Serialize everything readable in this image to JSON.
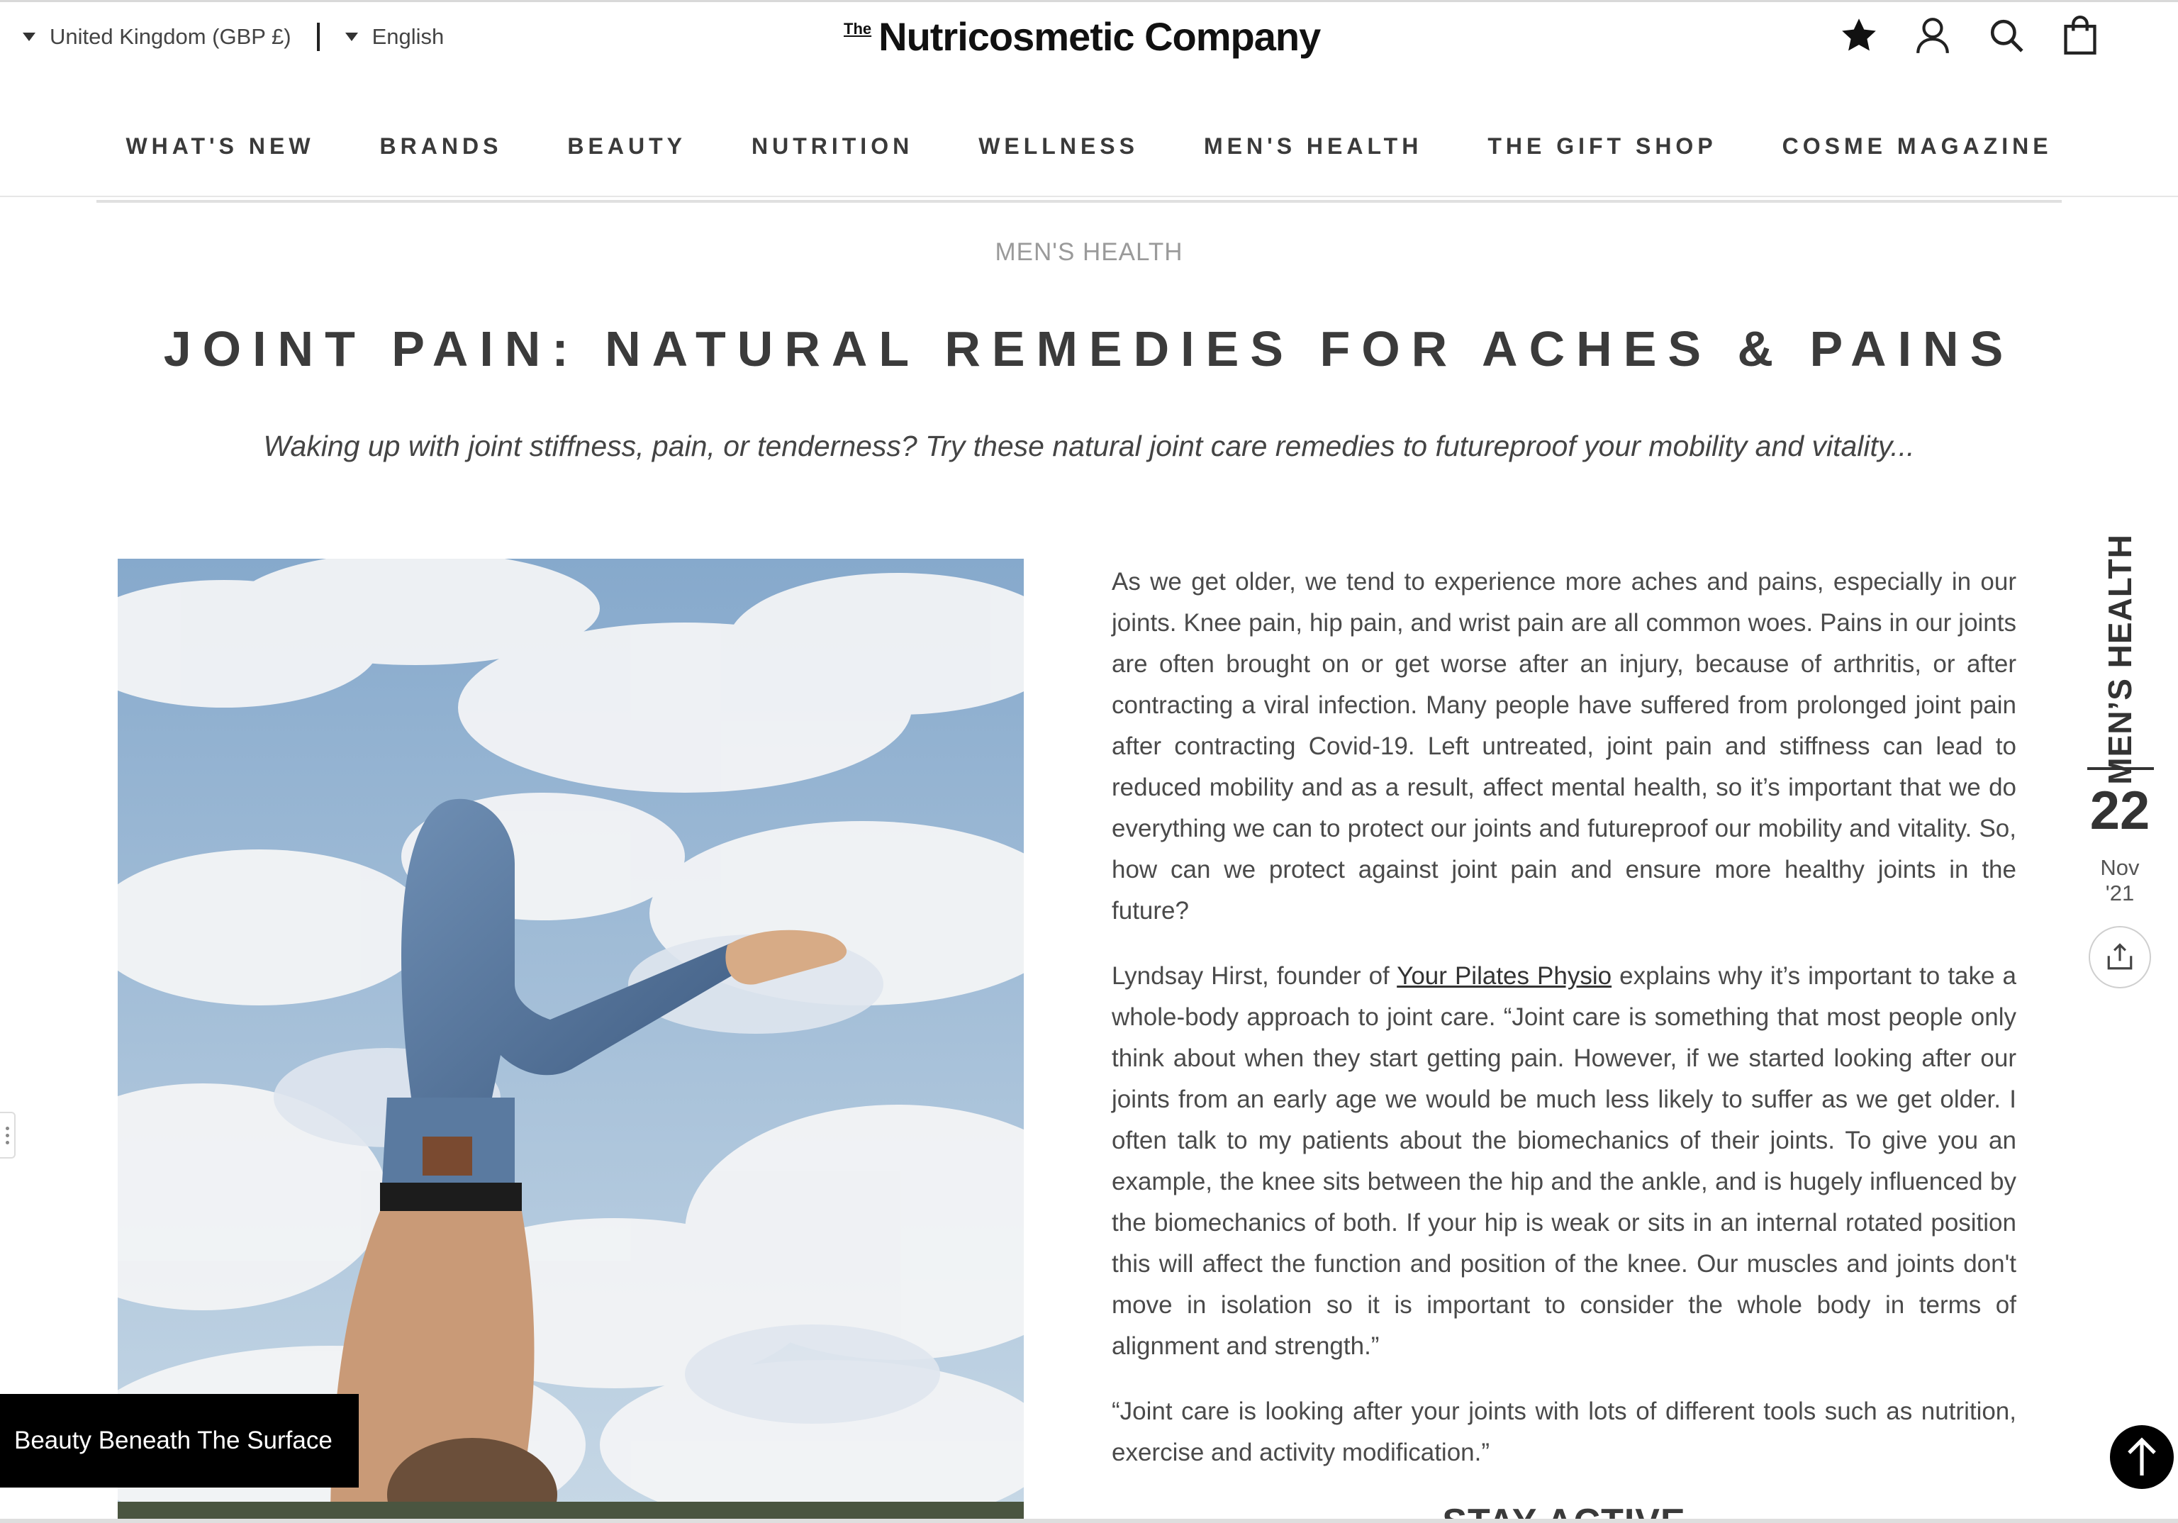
{
  "header": {
    "region_label": "United Kingdom (GBP £)",
    "language_label": "English",
    "logo_the": "The",
    "logo_name": "Nutricosmetic Company",
    "icons": [
      "star-icon",
      "account-icon",
      "search-icon",
      "bag-icon"
    ]
  },
  "nav": {
    "items": [
      {
        "label": "WHAT'S NEW"
      },
      {
        "label": "BRANDS"
      },
      {
        "label": "BEAUTY"
      },
      {
        "label": "NUTRITION"
      },
      {
        "label": "WELLNESS"
      },
      {
        "label": "MEN'S HEALTH"
      },
      {
        "label": "THE GIFT SHOP"
      },
      {
        "label": "COSME MAGAZINE"
      }
    ]
  },
  "article": {
    "category": "MEN'S HEALTH",
    "title": "JOINT PAIN: NATURAL REMEDIES FOR ACHES & PAINS",
    "subtitle": "Waking up with joint stiffness, pain, or tenderness? Try these natural joint care remedies to futureproof your mobility and vitality...",
    "p1": "As we get older, we tend to experience more aches and pains, especially in our joints. Knee pain, hip pain, and wrist pain are all common woes. Pains in our joints are often brought on or get worse after an injury, because of arthritis, or after contracting a viral infection. Many people have suffered from prolonged joint pain after contracting Covid-19. Left untreated, joint pain and stiffness can lead to reduced mobility and as a result, affect mental health, so it’s important that we do everything we can to protect our joints and futureproof our mobility and vitality. So, how can we protect against joint pain and ensure more healthy joints in the future?",
    "p2_before": "Lyndsay Hirst, founder of ",
    "p2_link": "Your Pilates Physio",
    "p2_after": " explains why it’s important to take a whole-body approach to joint care. “Joint care is something that most people only think about when they start getting pain. However, if we started looking after our joints from an early age we would be much less likely to suffer as we get older. I often talk to my patients about the biomechanics of their joints. To give you an example, the knee sits between the hip and the ankle, and is hugely influenced by the biomechanics of both. If your hip is weak or sits in an internal rotated position this will affect the function and position of the knee. Our muscles and joints don't move in isolation so it is important to consider the whole body in terms of alignment and strength.”",
    "p3": "“Joint care is looking after your joints with lots of different tools such as nutrition, exercise and activity modification.”",
    "section_heading": "STAY ACTIVE"
  },
  "rail": {
    "category": "MEN’S HEALTH",
    "day": "22",
    "month": "Nov",
    "year": "'21"
  },
  "promo": {
    "label": "Beauty Beneath The Surface"
  },
  "colors": {
    "text": "#3a3a3a",
    "muted": "#9a9a9a",
    "promo_bg": "#000000"
  }
}
